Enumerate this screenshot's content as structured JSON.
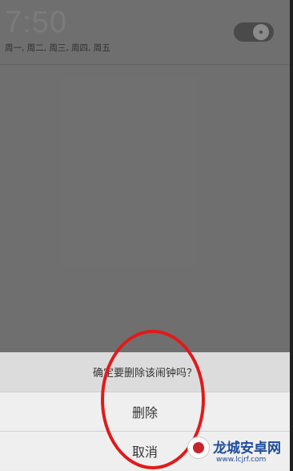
{
  "alarm": {
    "time": "7:50",
    "days": "周一, 周二, 周三, 周四, 周五",
    "enabled": false
  },
  "dialog": {
    "title": "确定要删除该闹钟吗？",
    "delete_label": "删除",
    "cancel_label": "取消"
  },
  "annotation": {
    "circle_color": "#e11a1a"
  },
  "watermark": {
    "title": "龙城安卓网",
    "url": "www.lcjrf.com"
  }
}
